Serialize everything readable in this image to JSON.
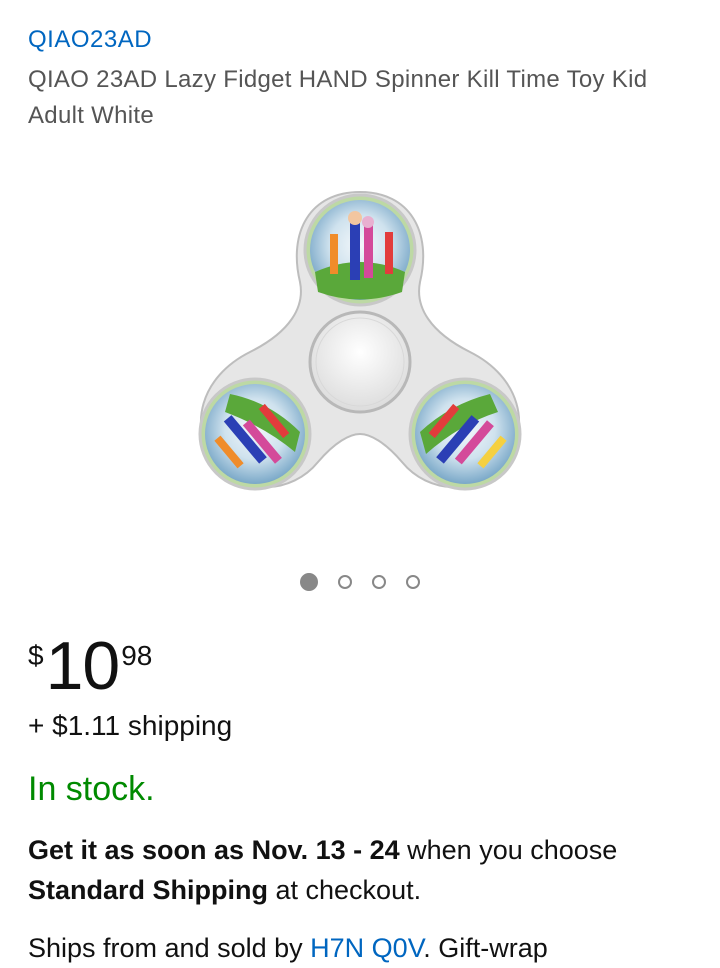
{
  "product": {
    "brand": "QIAO23AD",
    "title": "QIAO 23AD Lazy Fidget HAND Spinner Kill Time Toy Kid Adult White",
    "image_icon": "fidget-spinner-product-image"
  },
  "carousel": {
    "count": 4,
    "active_index": 0
  },
  "price": {
    "currency": "$",
    "whole": "10",
    "fraction": "98"
  },
  "shipping": {
    "text": "+ $1.11 shipping"
  },
  "availability": {
    "text": "In stock.",
    "color": "#008a00"
  },
  "delivery": {
    "lead": "Get it as soon as Nov. 13 - 24",
    "middle": " when you choose ",
    "method": "Standard Shipping",
    "tail": " at checkout."
  },
  "seller": {
    "prefix": "Ships from and sold by ",
    "name": "H7N Q0V",
    "suffix": ". Gift-wrap"
  },
  "colors": {
    "link": "#0066c0",
    "text": "#111111",
    "muted": "#555555"
  }
}
